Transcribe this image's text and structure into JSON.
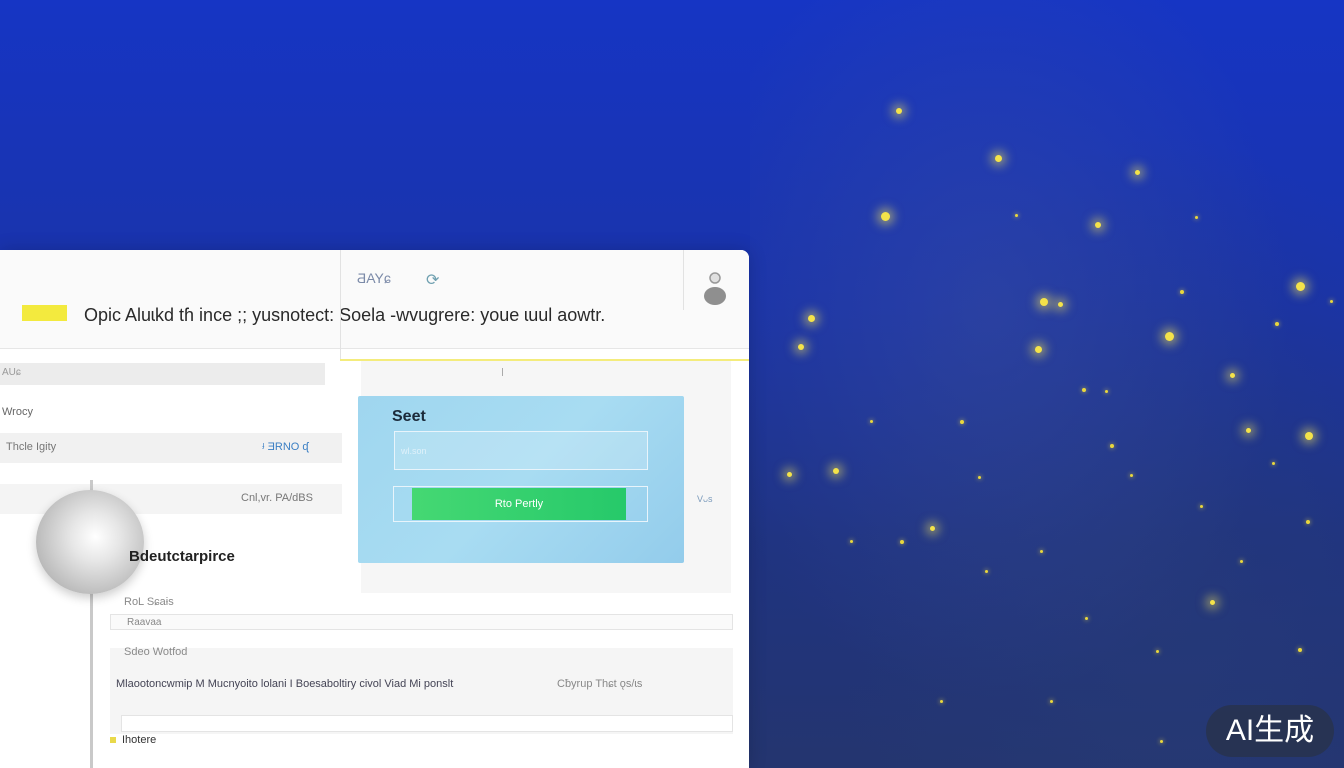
{
  "header": {
    "save_label": "ƋAYɕ",
    "headline": "Opic Aluɩkd tɦ ince ;; yusnotect: Soela -wvugrere: youe ɩuul aowtr."
  },
  "left_panel": {
    "row_a": "AUɕ",
    "row_b": "Wrocy",
    "row_c_left": "Thcle Igity",
    "row_c_right": "ᶡ ƎRNO ᶑ",
    "row_d_right": "Cnl,ᴠr. PA/dBS"
  },
  "card": {
    "title": "Seet",
    "input_placeholder": "wl.son",
    "button_label": "Rto Pertly"
  },
  "side_label": "Vᴗs",
  "section": {
    "title": "Bdeutctarpirce",
    "field1_label": "RoL Sɕaɨs",
    "field1_value": "Raavaa",
    "field2_label": "Sdeo Wotfod",
    "list_line": "Mlaootoncwmip M Mucnyoito lolani I Boesaboltiry civol Viad Mi ponslt",
    "list_right": "Cƀyrup Thɕt ǫs/ɩs",
    "last_item": "Ihotere"
  },
  "watermark": "AI生成",
  "colors": {
    "background": "#1635c4",
    "accent_yellow": "#f3ea3e",
    "card_blue": "#a8dcf2",
    "button_green": "#2fcf6d"
  },
  "icons": [
    "refresh-icon",
    "user-avatar-icon",
    "sparkle-icon"
  ]
}
